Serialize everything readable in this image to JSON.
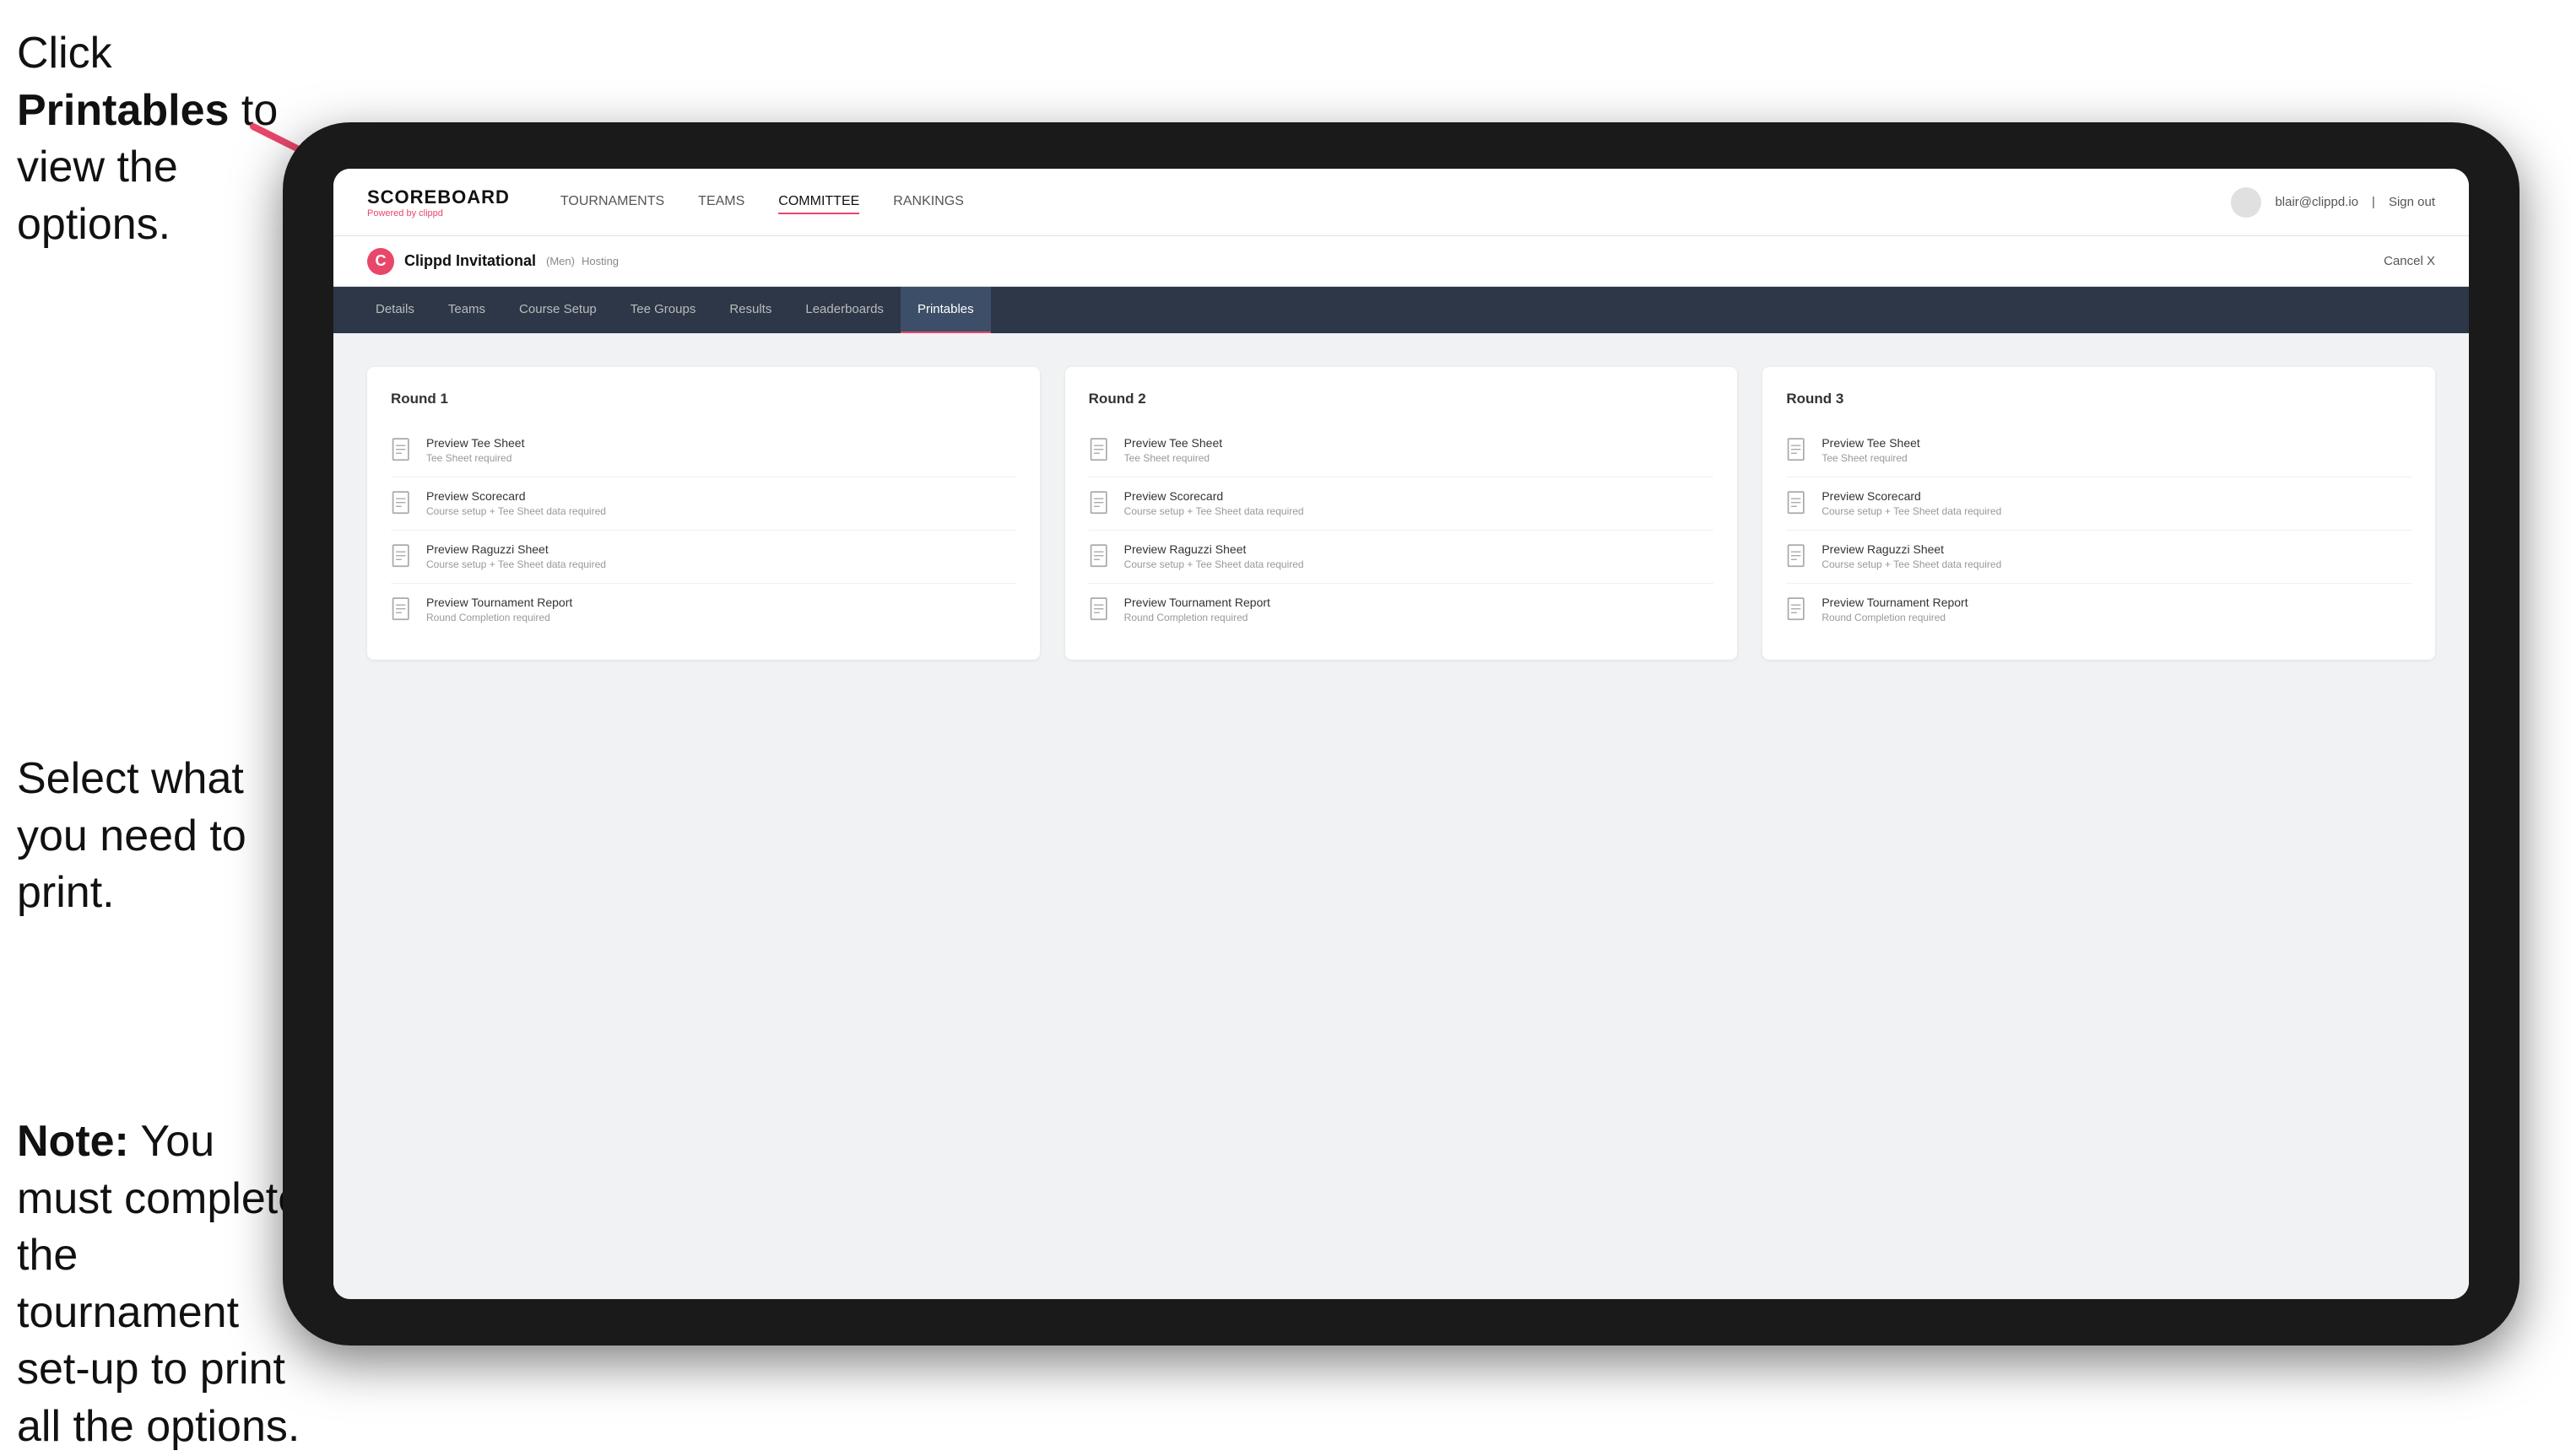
{
  "instructions": {
    "top_line1": "Click ",
    "top_bold": "Printables",
    "top_line2": " to",
    "top_line3": "view the options.",
    "middle": "Select what you\nneed to print.",
    "bottom_bold": "Note:",
    "bottom_text": " You must\ncomplete the\ntournament set-up\nto print all the options."
  },
  "top_nav": {
    "logo_title": "SCOREBOARD",
    "powered_by": "Powered by clippd",
    "nav_items": [
      {
        "label": "TOURNAMENTS",
        "active": false
      },
      {
        "label": "TEAMS",
        "active": false
      },
      {
        "label": "COMMITTEE",
        "active": true
      },
      {
        "label": "RANKINGS",
        "active": false
      }
    ],
    "user_email": "blair@clippd.io",
    "sign_out": "Sign out"
  },
  "tournament_header": {
    "logo_letter": "C",
    "name": "Clippd Invitational",
    "badge": "(Men)",
    "status": "Hosting",
    "cancel": "Cancel X"
  },
  "sub_nav": {
    "items": [
      {
        "label": "Details",
        "active": false
      },
      {
        "label": "Teams",
        "active": false
      },
      {
        "label": "Course Setup",
        "active": false
      },
      {
        "label": "Tee Groups",
        "active": false
      },
      {
        "label": "Results",
        "active": false
      },
      {
        "label": "Leaderboards",
        "active": false
      },
      {
        "label": "Printables",
        "active": true
      }
    ]
  },
  "rounds": [
    {
      "title": "Round 1",
      "items": [
        {
          "title": "Preview Tee Sheet",
          "subtitle": "Tee Sheet required"
        },
        {
          "title": "Preview Scorecard",
          "subtitle": "Course setup + Tee Sheet data required"
        },
        {
          "title": "Preview Raguzzi Sheet",
          "subtitle": "Course setup + Tee Sheet data required"
        },
        {
          "title": "Preview Tournament Report",
          "subtitle": "Round Completion required"
        }
      ]
    },
    {
      "title": "Round 2",
      "items": [
        {
          "title": "Preview Tee Sheet",
          "subtitle": "Tee Sheet required"
        },
        {
          "title": "Preview Scorecard",
          "subtitle": "Course setup + Tee Sheet data required"
        },
        {
          "title": "Preview Raguzzi Sheet",
          "subtitle": "Course setup + Tee Sheet data required"
        },
        {
          "title": "Preview Tournament Report",
          "subtitle": "Round Completion required"
        }
      ]
    },
    {
      "title": "Round 3",
      "items": [
        {
          "title": "Preview Tee Sheet",
          "subtitle": "Tee Sheet required"
        },
        {
          "title": "Preview Scorecard",
          "subtitle": "Course setup + Tee Sheet data required"
        },
        {
          "title": "Preview Raguzzi Sheet",
          "subtitle": "Course setup + Tee Sheet data required"
        },
        {
          "title": "Preview Tournament Report",
          "subtitle": "Round Completion required"
        }
      ]
    }
  ]
}
